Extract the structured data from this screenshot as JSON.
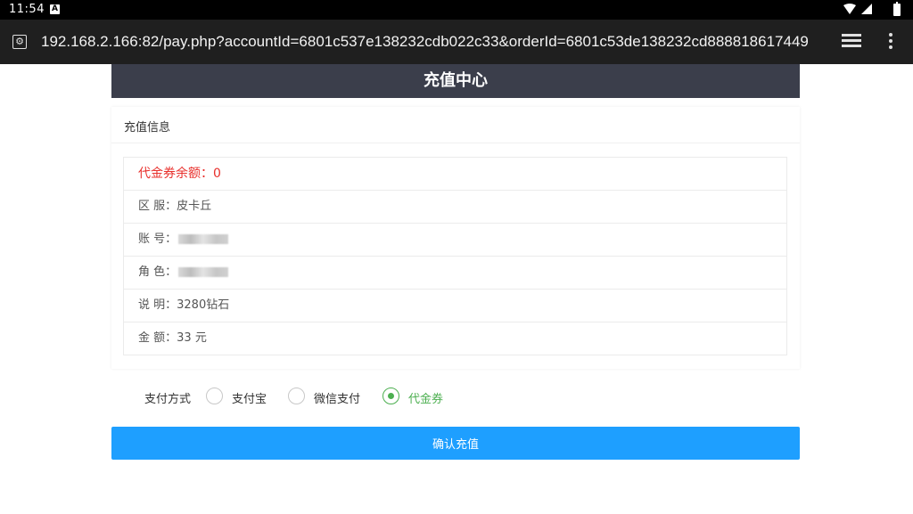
{
  "status_bar": {
    "time": "11:54",
    "notification_icon": "A",
    "icons": [
      "wifi-icon",
      "signal-icon",
      "battery-icon"
    ]
  },
  "browser": {
    "url": "192.168.2.166:82/pay.php?accountId=6801c537e138232cdb022c33&orderId=6801c53de138232cd888818617449",
    "icons": [
      "site-info-icon",
      "tabs-icon",
      "menu-icon"
    ]
  },
  "header": {
    "title": "充值中心"
  },
  "card": {
    "title": "充值信息",
    "voucher_balance": "代金券余额：0",
    "rows": [
      {
        "label": "区 服：",
        "value": "皮卡丘"
      },
      {
        "label": "账 号：",
        "value": ""
      },
      {
        "label": "角 色：",
        "value": ""
      },
      {
        "label": "说 明：",
        "value": "3280钻石"
      },
      {
        "label": "金 额：",
        "value": "33 元"
      }
    ]
  },
  "payment": {
    "label": "支付方式",
    "options": [
      {
        "label": "支付宝",
        "checked": false
      },
      {
        "label": "微信支付",
        "checked": false
      },
      {
        "label": "代金券",
        "checked": true
      }
    ]
  },
  "confirm_button": "确认充值",
  "colors": {
    "header_bg": "#3b3e4b",
    "accent_blue": "#1e9fff",
    "accent_green": "#4caf50",
    "alert_red": "#e8302c"
  }
}
